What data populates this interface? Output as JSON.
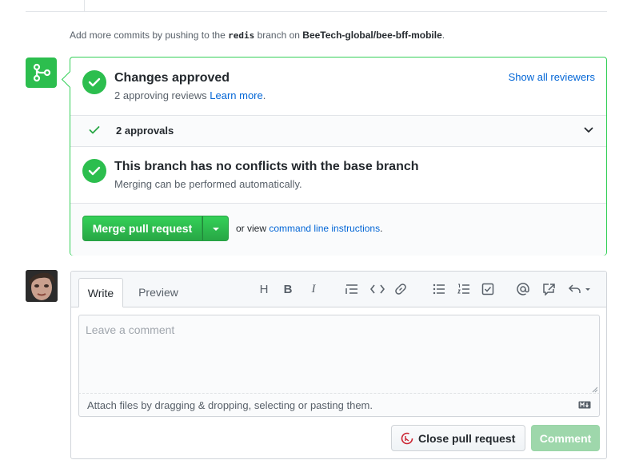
{
  "commit_note": {
    "prefix": "Add more commits by pushing to the",
    "branch": "redis",
    "middle": "branch on",
    "repo": "BeeTech-global/bee-bff-mobile",
    "suffix": "."
  },
  "approval": {
    "title": "Changes approved",
    "subtitle": "2 approving reviews",
    "learn_more": "Learn more",
    "period": ".",
    "show_all": "Show all reviewers"
  },
  "approvals_row": {
    "label": "2 approvals"
  },
  "conflicts": {
    "title": "This branch has no conflicts with the base branch",
    "subtitle": "Merging can be performed automatically."
  },
  "merge": {
    "button_label": "Merge pull request",
    "alt_prefix": "or view",
    "alt_link": "command line instructions",
    "alt_suffix": "."
  },
  "comment": {
    "tab_write": "Write",
    "tab_preview": "Preview",
    "toolbar": {
      "heading": "H",
      "bold": "B",
      "italic": "I"
    },
    "placeholder": "Leave a comment",
    "attach_text": "Attach files by dragging & dropping, selecting or pasting them.",
    "close_button": "Close pull request",
    "comment_button": "Comment"
  },
  "colors": {
    "success": "#2cbe4e",
    "link": "#0366d6",
    "close_icon": "#cb2431",
    "comment_disabled": "#94d3a2"
  },
  "icons": {
    "merge_status": "git-branch-icon",
    "check": "check-icon",
    "chevron": "chevron-down-icon",
    "close_pr": "git-pull-request-closed-icon"
  }
}
